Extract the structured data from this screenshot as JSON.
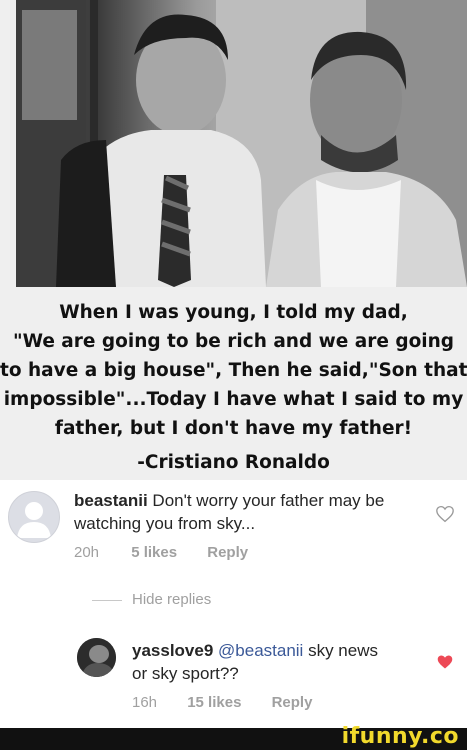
{
  "meme": {
    "caption_lines": [
      "When I was young, I told my dad,",
      "\"We are going to be rich and we are going",
      "to have a big house\", Then he said,\"Son that's",
      "impossible\"...Today I have what I said to my",
      "father, but I don't have my father!"
    ],
    "attribution": "-Cristiano Ronaldo"
  },
  "comment": {
    "username": "beastanii",
    "text_line1": " Don't worry your father may be",
    "text_line2": "watching you from sky...",
    "time": "20h",
    "likes": "5 likes",
    "reply": "Reply",
    "avatar_icon": "default-avatar-icon",
    "like_icon": "heart-outline-icon",
    "liked": false
  },
  "hide_replies": "Hide replies",
  "reply": {
    "username": "yasslove9",
    "mention": "@beastanii",
    "text_line1": " sky news",
    "text_line2": "or sky sport??",
    "time": "16h",
    "likes": "15 likes",
    "reply": "Reply",
    "avatar_icon": "user-photo-avatar",
    "like_icon": "heart-filled-icon",
    "liked": true,
    "like_color": "#ed4956"
  },
  "watermark": "ifunny.co",
  "colors": {
    "footer": "#111111",
    "watermark": "#f1d92c",
    "meta_text": "#a0a0a0"
  }
}
